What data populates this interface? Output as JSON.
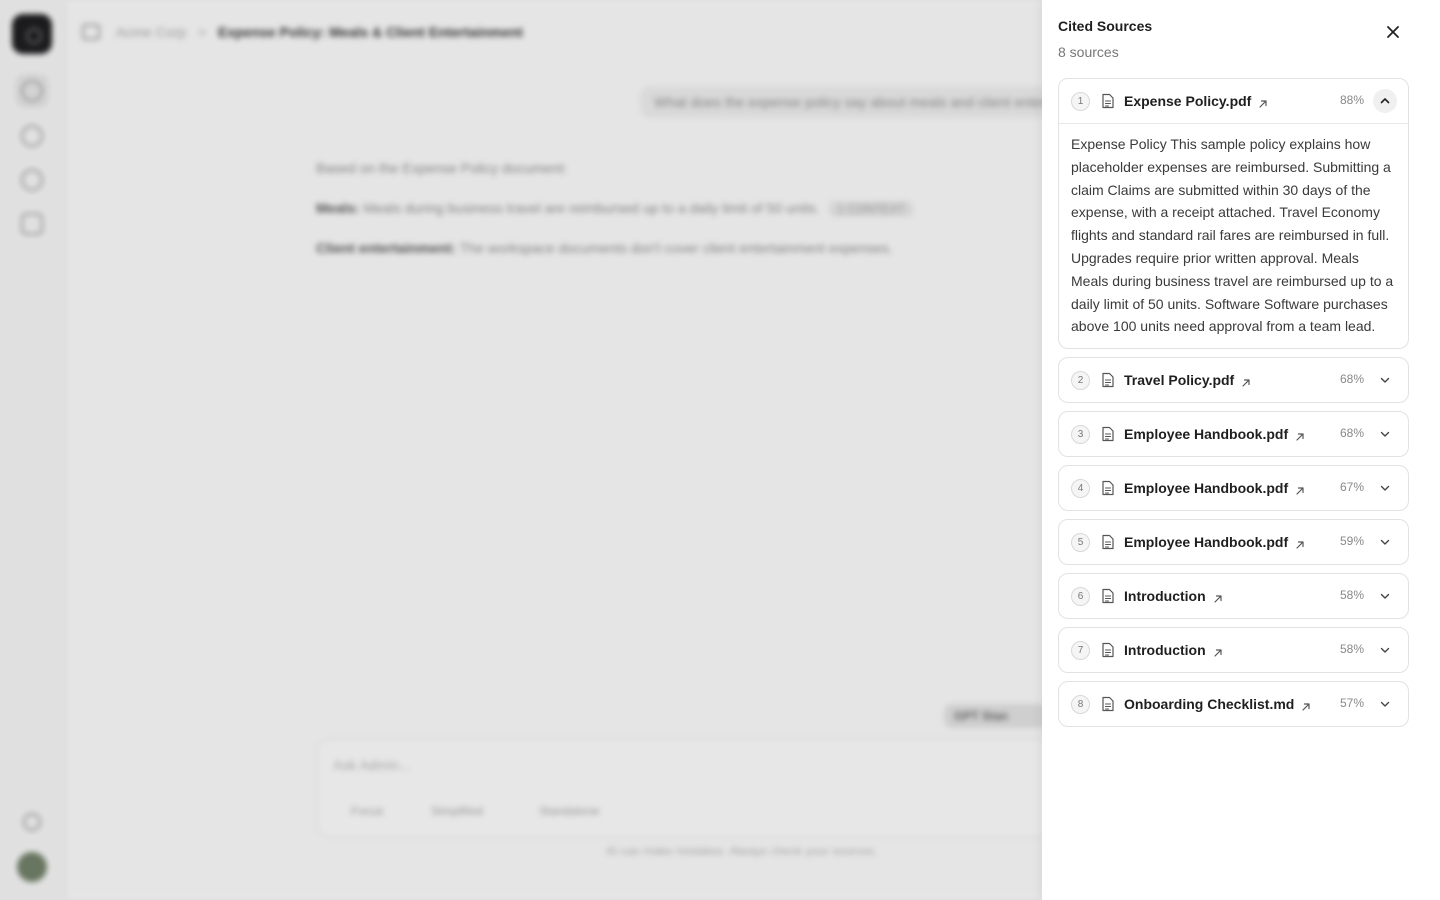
{
  "background": {
    "breadcrumb": {
      "workspace": "Acme Corp",
      "separator": ">",
      "title": "Expense Policy: Meals & Client Entertainment"
    },
    "user_message": "What does the expense policy say about meals and client entertainment?",
    "answer": {
      "intro": "Based on the Expense Policy document:",
      "meals_label": "Meals:",
      "meals_text": "Meals during business travel are reimbursed up to a daily limit of 50 units.",
      "meals_citation": "1 CONTEXT",
      "client_label": "Client entertainment:",
      "client_text": "The workspace documents don't cover client entertainment expenses."
    },
    "model_chip": "GPT Stan",
    "composer": {
      "placeholder": "Ask Admin...",
      "tools": [
        "Focus",
        "Simplified",
        "Standalone"
      ]
    },
    "disclaimer": "AI can make mistakes. Always check your sources."
  },
  "panel": {
    "title": "Cited Sources",
    "subtitle": "8 sources",
    "close_icon": "close-icon",
    "sources": [
      {
        "index": "1",
        "name": "Expense Policy.pdf",
        "score": "88%",
        "expanded": true,
        "excerpt": "Expense Policy This sample policy explains how placeholder expenses are reimbursed. Submitting a claim Claims are submitted within 30 days of the expense, with a receipt attached. Travel Economy flights and standard rail fares are reimbursed in full. Upgrades require prior written approval. Meals Meals during business travel are reimbursed up to a daily limit of 50 units. Software Software purchases above 100 units need approval from a team lead."
      },
      {
        "index": "2",
        "name": "Travel Policy.pdf",
        "score": "68%",
        "expanded": false
      },
      {
        "index": "3",
        "name": "Employee Handbook.pdf",
        "score": "68%",
        "expanded": false
      },
      {
        "index": "4",
        "name": "Employee Handbook.pdf",
        "score": "67%",
        "expanded": false
      },
      {
        "index": "5",
        "name": "Employee Handbook.pdf",
        "score": "59%",
        "expanded": false
      },
      {
        "index": "6",
        "name": "Introduction",
        "score": "58%",
        "expanded": false
      },
      {
        "index": "7",
        "name": "Introduction",
        "score": "58%",
        "expanded": false
      },
      {
        "index": "8",
        "name": "Onboarding Checklist.md",
        "score": "57%",
        "expanded": false
      }
    ]
  }
}
